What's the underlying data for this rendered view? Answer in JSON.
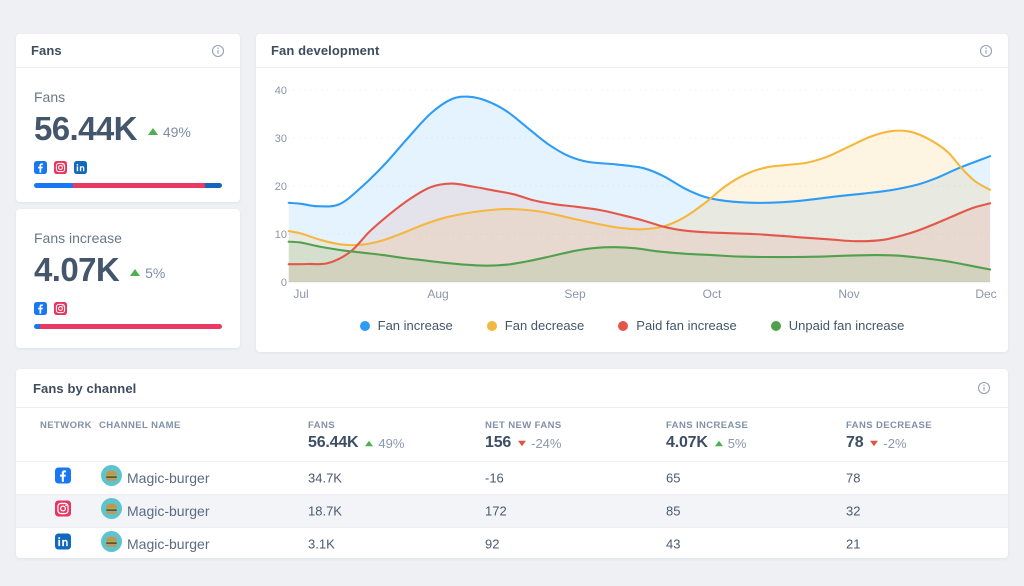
{
  "colors": {
    "page_bg": "#eef0f4",
    "card_bg": "#ffffff",
    "positive": "#4caf50",
    "negative": "#e0533f",
    "facebook": "#1877f2",
    "instagram": "#e8355f",
    "linkedin": "#1268bd"
  },
  "cards": {
    "fans": {
      "title": "Fans",
      "info_icon": "info-icon",
      "metric": {
        "label": "Fans",
        "value": "56.44K",
        "delta": "49%",
        "delta_dir": "up",
        "networks": [
          "facebook",
          "instagram",
          "linkedin"
        ],
        "bar": [
          {
            "network": "facebook",
            "color": "#1877f2",
            "pct": 20.5
          },
          {
            "network": "instagram",
            "color": "#ea3a64",
            "pct": 70.2
          },
          {
            "network": "linkedin",
            "color": "#1565c0",
            "pct": 9.3
          }
        ]
      }
    },
    "fans_increase": {
      "metric": {
        "label": "Fans increase",
        "value": "4.07K",
        "delta": "5%",
        "delta_dir": "up",
        "networks": [
          "facebook",
          "instagram"
        ],
        "bar": [
          {
            "network": "facebook",
            "color": "#1877f2",
            "pct": 3.2
          },
          {
            "network": "instagram",
            "color": "#ea3a64",
            "pct": 96.8
          }
        ]
      }
    },
    "fan_development": {
      "title": "Fan development",
      "info_icon": "info-icon"
    },
    "fans_by_channel": {
      "title": "Fans by channel",
      "info_icon": "info-icon",
      "columns": [
        "NETWORK",
        "CHANNEL NAME",
        "FANS",
        "NET NEW FANS",
        "FANS INCREASE",
        "FANS DECREASE"
      ],
      "summary": [
        {
          "column": "Fans",
          "value": "56.44K",
          "delta": "49%",
          "dir": "up"
        },
        {
          "column": "Net new fans",
          "value": "156",
          "delta": "-24%",
          "dir": "down"
        },
        {
          "column": "Fans increase",
          "value": "4.07K",
          "delta": "5%",
          "dir": "up"
        },
        {
          "column": "Fans decrease",
          "value": "78",
          "delta": "-2%",
          "dir": "down"
        }
      ],
      "rows": [
        {
          "network": "facebook",
          "channel": "Magic-burger",
          "fans": "34.7K",
          "net_new_fans": "-16",
          "fans_increase": "65",
          "fans_decrease": "78"
        },
        {
          "network": "instagram",
          "channel": "Magic-burger",
          "fans": "18.7K",
          "net_new_fans": "172",
          "fans_increase": "85",
          "fans_decrease": "32"
        },
        {
          "network": "linkedin",
          "channel": "Magic-burger",
          "fans": "3.1K",
          "net_new_fans": "92",
          "fans_increase": "43",
          "fans_decrease": "21"
        }
      ]
    }
  },
  "chart_data": {
    "type": "area",
    "title": "Fan development",
    "x_unit": "months (0 = Jul tick, 5 = Dec tick)",
    "x_labels": [
      "Jul",
      "Aug",
      "Sep",
      "Oct",
      "Nov",
      "Dec"
    ],
    "y_ticks": [
      0,
      10,
      20,
      30,
      40
    ],
    "ylim": [
      0,
      40
    ],
    "grid": "faint dotted horizontal",
    "legend_position": "bottom",
    "series": [
      {
        "name": "Fan increase",
        "color": "#2d9cf4",
        "points": [
          [
            -0.09,
            16.5
          ],
          [
            0,
            16.3
          ],
          [
            0.12,
            15.8
          ],
          [
            0.28,
            16.2
          ],
          [
            0.45,
            20.0
          ],
          [
            0.62,
            24.8
          ],
          [
            0.78,
            30.0
          ],
          [
            0.95,
            35.2
          ],
          [
            1.1,
            38.1
          ],
          [
            1.22,
            38.6
          ],
          [
            1.35,
            37.8
          ],
          [
            1.5,
            35.6
          ],
          [
            1.65,
            32.2
          ],
          [
            1.8,
            28.8
          ],
          [
            1.95,
            26.3
          ],
          [
            2.1,
            25.0
          ],
          [
            2.3,
            24.5
          ],
          [
            2.5,
            23.7
          ],
          [
            2.65,
            22.0
          ],
          [
            2.8,
            19.5
          ],
          [
            2.95,
            17.7
          ],
          [
            3.1,
            16.9
          ],
          [
            3.3,
            16.5
          ],
          [
            3.5,
            16.6
          ],
          [
            3.7,
            17.1
          ],
          [
            3.9,
            17.8
          ],
          [
            4.1,
            18.4
          ],
          [
            4.3,
            19.1
          ],
          [
            4.5,
            20.3
          ],
          [
            4.65,
            21.8
          ],
          [
            4.8,
            23.7
          ],
          [
            5.03,
            26.2
          ]
        ]
      },
      {
        "name": "Fan decrease",
        "color": "#f5b73d",
        "points": [
          [
            -0.09,
            10.6
          ],
          [
            0,
            10.1
          ],
          [
            0.15,
            8.7
          ],
          [
            0.3,
            7.8
          ],
          [
            0.45,
            7.8
          ],
          [
            0.6,
            8.7
          ],
          [
            0.75,
            10.3
          ],
          [
            0.9,
            12.0
          ],
          [
            1.05,
            13.4
          ],
          [
            1.2,
            14.3
          ],
          [
            1.35,
            14.9
          ],
          [
            1.5,
            15.2
          ],
          [
            1.65,
            15.0
          ],
          [
            1.8,
            14.4
          ],
          [
            2.0,
            13.1
          ],
          [
            2.2,
            11.9
          ],
          [
            2.35,
            11.2
          ],
          [
            2.5,
            11.0
          ],
          [
            2.65,
            11.6
          ],
          [
            2.8,
            13.5
          ],
          [
            2.95,
            16.5
          ],
          [
            3.1,
            20.0
          ],
          [
            3.25,
            22.5
          ],
          [
            3.4,
            23.9
          ],
          [
            3.55,
            24.4
          ],
          [
            3.7,
            24.9
          ],
          [
            3.85,
            26.2
          ],
          [
            4.0,
            28.2
          ],
          [
            4.15,
            30.2
          ],
          [
            4.3,
            31.4
          ],
          [
            4.45,
            31.3
          ],
          [
            4.6,
            29.5
          ],
          [
            4.72,
            27.1
          ],
          [
            4.82,
            23.8
          ],
          [
            4.92,
            21.0
          ],
          [
            5.03,
            19.2
          ]
        ]
      },
      {
        "name": "Paid fan increase",
        "color": "#e3574a",
        "points": [
          [
            -0.09,
            3.7
          ],
          [
            0.05,
            3.75
          ],
          [
            0.2,
            3.95
          ],
          [
            0.36,
            6.3
          ],
          [
            0.5,
            10.5
          ],
          [
            0.65,
            14.2
          ],
          [
            0.8,
            17.4
          ],
          [
            0.95,
            19.8
          ],
          [
            1.1,
            20.5
          ],
          [
            1.25,
            19.9
          ],
          [
            1.4,
            19.1
          ],
          [
            1.55,
            18.3
          ],
          [
            1.7,
            17.0
          ],
          [
            1.85,
            16.2
          ],
          [
            2.0,
            15.7
          ],
          [
            2.18,
            15.0
          ],
          [
            2.35,
            13.9
          ],
          [
            2.5,
            12.8
          ],
          [
            2.65,
            11.5
          ],
          [
            2.8,
            10.7
          ],
          [
            3.0,
            10.3
          ],
          [
            3.3,
            10.0
          ],
          [
            3.6,
            9.4
          ],
          [
            3.85,
            8.9
          ],
          [
            4.05,
            8.5
          ],
          [
            4.25,
            8.8
          ],
          [
            4.45,
            10.2
          ],
          [
            4.6,
            11.8
          ],
          [
            4.75,
            13.6
          ],
          [
            4.9,
            15.4
          ],
          [
            5.03,
            16.4
          ]
        ]
      },
      {
        "name": "Unpaid fan increase",
        "color": "#51a04d",
        "points": [
          [
            -0.09,
            8.4
          ],
          [
            0,
            8.2
          ],
          [
            0.15,
            7.3
          ],
          [
            0.3,
            6.6
          ],
          [
            0.45,
            6.1
          ],
          [
            0.6,
            5.6
          ],
          [
            0.75,
            5.0
          ],
          [
            0.9,
            4.5
          ],
          [
            1.05,
            4.0
          ],
          [
            1.2,
            3.6
          ],
          [
            1.35,
            3.4
          ],
          [
            1.5,
            3.6
          ],
          [
            1.65,
            4.3
          ],
          [
            1.8,
            5.2
          ],
          [
            2.0,
            6.5
          ],
          [
            2.15,
            7.1
          ],
          [
            2.3,
            7.25
          ],
          [
            2.45,
            7.0
          ],
          [
            2.6,
            6.4
          ],
          [
            2.8,
            5.9
          ],
          [
            3.0,
            5.6
          ],
          [
            3.2,
            5.3
          ],
          [
            3.4,
            5.2
          ],
          [
            3.6,
            5.2
          ],
          [
            3.8,
            5.3
          ],
          [
            4.0,
            5.5
          ],
          [
            4.2,
            5.6
          ],
          [
            4.35,
            5.5
          ],
          [
            4.5,
            5.1
          ],
          [
            4.7,
            4.4
          ],
          [
            4.85,
            3.6
          ],
          [
            5.03,
            2.6
          ]
        ]
      }
    ]
  }
}
